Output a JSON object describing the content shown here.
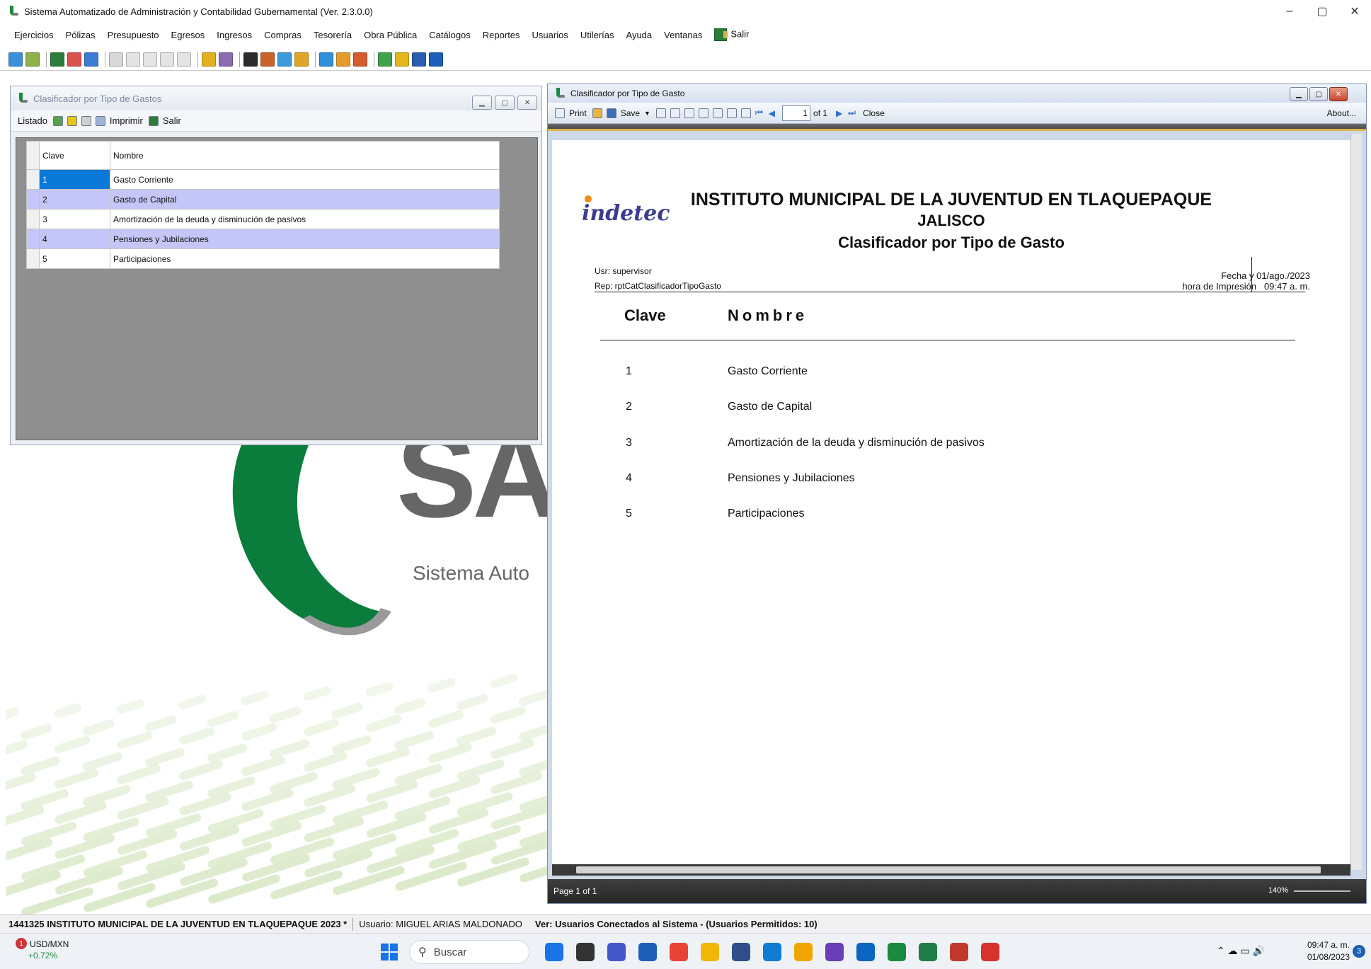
{
  "app": {
    "title": "Sistema Automatizado de Administración y Contabilidad Gubernamental  (Ver. 2.3.0.0)",
    "controls": [
      "–",
      "▢",
      "✕"
    ]
  },
  "menu": [
    "Ejercicios",
    "Pólizas",
    "Presupuesto",
    "Egresos",
    "Ingresos",
    "Compras",
    "Tesorería",
    "Obra Pública",
    "Catálogos",
    "Reportes",
    "Usuarios",
    "Utilerías",
    "Ayuda",
    "Ventanas",
    "Salir"
  ],
  "toolbar_colors": [
    "#3a8fd6",
    "#8fb04a",
    "#2c7d3a",
    "#d9534f",
    "#3a7bd5",
    "#d8d8d8",
    "#e4e4e4",
    "#e4e4e4",
    "#e4e4e4",
    "#e4e4e4",
    "#e0b020",
    "#8c6bb1",
    "#2b2b2b",
    "#c9632a",
    "#3b9ad9",
    "#e0a526",
    "#2f8fd8",
    "#e39c29",
    "#d65b2e",
    "#3fa24c",
    "#e3b61d",
    "#2a5fb0",
    "#1b5fb8"
  ],
  "left_window": {
    "title": "Clasificador por Tipo de Gastos",
    "toolbar": {
      "listado": "Listado",
      "imprimir": "Imprimir",
      "salir": "Salir"
    },
    "columns": [
      "Clave",
      "Nombre"
    ],
    "rows": [
      {
        "clave": "1",
        "nombre": "Gasto Corriente"
      },
      {
        "clave": "2",
        "nombre": "Gasto de Capital"
      },
      {
        "clave": "3",
        "nombre": "Amortización de la deuda y disminución de pasivos"
      },
      {
        "clave": "4",
        "nombre": "Pensiones y Jubilaciones"
      },
      {
        "clave": "5",
        "nombre": "Participaciones"
      }
    ]
  },
  "right_window": {
    "title": "Clasificador por Tipo de Gasto",
    "toolbar": {
      "print": "Print",
      "save": "Save",
      "page": "1",
      "of": "of 1",
      "close": "Close",
      "about": "About..."
    },
    "status": "Page 1 of 1",
    "zoom": "140%"
  },
  "report": {
    "logo": "indetec",
    "title": "INSTITUTO MUNICIPAL DE LA JUVENTUD EN TLAQUEPAQUE",
    "subtitle": "JALISCO",
    "name": "Clasificador por Tipo de Gasto",
    "usr": "Usr: supervisor",
    "rep": "Rep: rptCatClasificadorTipoGasto",
    "fecha_label": "Fecha y",
    "fecha_value": "01/ago./2023",
    "hora_label": "hora de Impresión",
    "hora_value": "09:47 a. m.",
    "col_clave": "Clave",
    "col_nombre": "Nombre",
    "rows": [
      {
        "clave": "1",
        "nombre": "Gasto Corriente"
      },
      {
        "clave": "2",
        "nombre": "Gasto de Capital"
      },
      {
        "clave": "3",
        "nombre": "Amortización de la deuda y disminución de pasivos"
      },
      {
        "clave": "4",
        "nombre": "Pensiones y Jubilaciones"
      },
      {
        "clave": "5",
        "nombre": "Participaciones"
      }
    ]
  },
  "background": {
    "brand": "SA",
    "tagline": "Sistema Auto"
  },
  "statusbar": {
    "entity": "1441325 INSTITUTO MUNICIPAL DE LA JUVENTUD EN TLAQUEPAQUE  2023   *",
    "user": "Usuario: MIGUEL ARIAS MALDONADO",
    "connected": "Ver: Usuarios Conectados al Sistema - (Usuarios Permitidos: 10)"
  },
  "taskbar": {
    "weather_label": "USD/MXN",
    "weather_change": "+0.72%",
    "weather_badge": "1",
    "search": "Buscar",
    "time": "09:47 a. m.",
    "date": "01/08/2023",
    "notifications": "3",
    "app_colors": [
      "#1a73e8",
      "#333333",
      "#4457c9",
      "#1e5eb8",
      "#ea4335",
      "#f2b705",
      "#2e4f8c",
      "#0f7bd1",
      "#f0a500",
      "#6a3fb5",
      "#0a66c2",
      "#1a8a3f",
      "#1d7d45",
      "#c0392b",
      "#d6332c"
    ]
  }
}
